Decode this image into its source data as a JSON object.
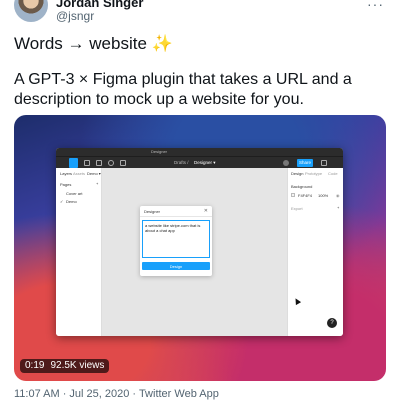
{
  "author": {
    "name": "Jordan Singer",
    "handle": "@jsngr"
  },
  "tweet": {
    "line1": "Words → website ✨",
    "body": "A GPT-3 × Figma plugin that takes a URL and a description to mock up a website for you."
  },
  "video": {
    "time": "0:19",
    "views": "92.5K views"
  },
  "figma": {
    "window_title": "Designer",
    "toolbar": {
      "breadcrumb": "Drafts /",
      "file": "Designer ▾",
      "share": "Share"
    },
    "left_panel": {
      "tab_layers": "Layers",
      "tab_assets": "Assets",
      "tab_demo": "Demo ▾",
      "section_pages": "Pages",
      "page_cover": "Cover art",
      "page_demo": "Demo"
    },
    "right_panel": {
      "tab_design": "Design",
      "tab_prototype": "Prototype",
      "tab_code": "Code",
      "section_background": "Background",
      "bg_hex": "F4F4F4",
      "bg_opacity": "100%",
      "section_export": "Export"
    },
    "plugin": {
      "title": "Designer",
      "close": "✕",
      "input_value": "a website like stripe.com that is about a chat app",
      "button": "Design"
    },
    "help": "?"
  },
  "meta": {
    "timestamp": "11:07 AM · Jul 25, 2020 · Twitter Web App"
  },
  "colors": {
    "accent": "#18a0fb",
    "text": "#0f1419",
    "muted": "#536471"
  }
}
